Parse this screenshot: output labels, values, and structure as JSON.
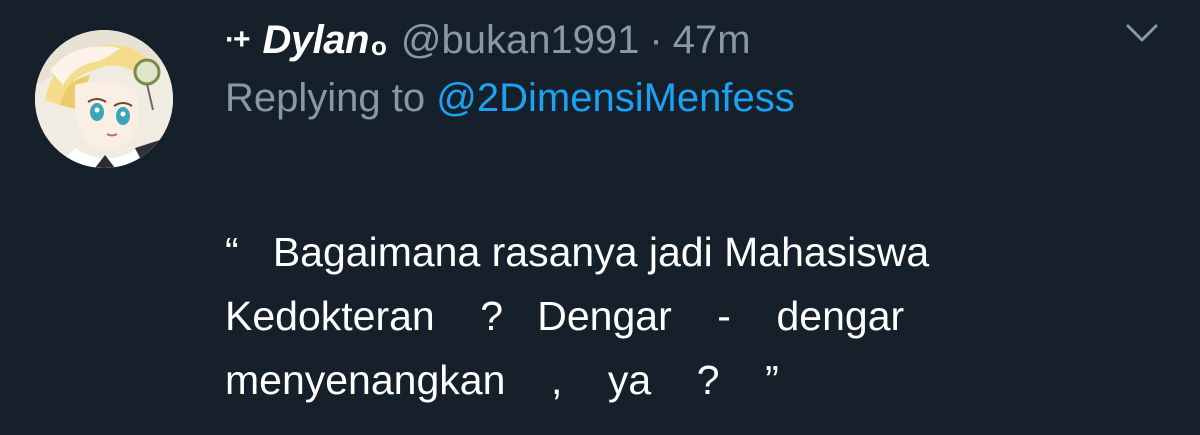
{
  "tweet": {
    "author": {
      "name_prefix": "·+",
      "display_name": "Dylan",
      "name_suffix": "o",
      "handle": "@bukan1991",
      "separator": "·",
      "time": "47m",
      "avatar_icon": "anime-avatar"
    },
    "reply": {
      "prefix": "Replying to",
      "target": "@2DimensiMenfess"
    },
    "body_lines": [
      "“   Bagaimana rasanya jadi Mahasiswa",
      "Kedokteran    ?   Dengar    -    dengar",
      "menyenangkan    ,    ya    ?    ”"
    ],
    "menu_icon": "chevron-down-icon"
  },
  "colors": {
    "background": "#15202b",
    "secondary_text": "#8899a6",
    "link": "#1da1f2",
    "primary_text": "#ffffff"
  }
}
